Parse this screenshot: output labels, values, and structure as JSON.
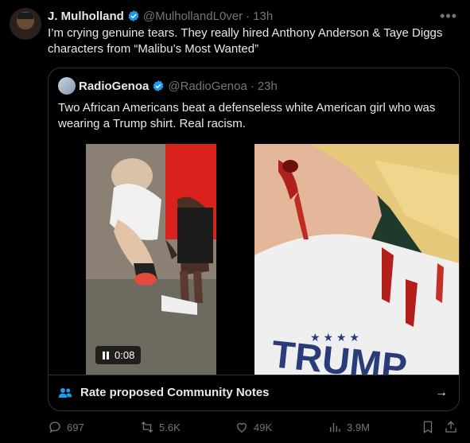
{
  "tweet": {
    "author_name": "J. Mulholland",
    "author_handle": "@MulhollandL0ver",
    "time": "13h",
    "text": "I’m crying genuine tears. They really hired Anthony Anderson & Taye Diggs characters from “Malibu’s Most Wanted”"
  },
  "quoted": {
    "author_name": "RadioGenoa",
    "author_handle": "@RadioGenoa",
    "time": "23h",
    "text": "Two African Americans beat a defenseless white American girl who was wearing a Trump shirt. Real racism.",
    "video_duration": "0:08",
    "community_notes_label": "Rate proposed Community Notes"
  },
  "actions": {
    "replies": "697",
    "reposts": "5.6K",
    "likes": "49K",
    "views": "3.9M"
  },
  "colors": {
    "background": "#000000",
    "text": "#e7e9ea",
    "muted": "#71767b",
    "verified": "#1d9bf0",
    "notes_icon": "#1d9bf0"
  },
  "icons": [
    "verified-badge-icon",
    "more-icon",
    "pause-icon",
    "community-notes-icon",
    "arrow-right-icon",
    "reply-icon",
    "repost-icon",
    "like-icon",
    "views-icon",
    "bookmark-icon",
    "share-icon"
  ]
}
